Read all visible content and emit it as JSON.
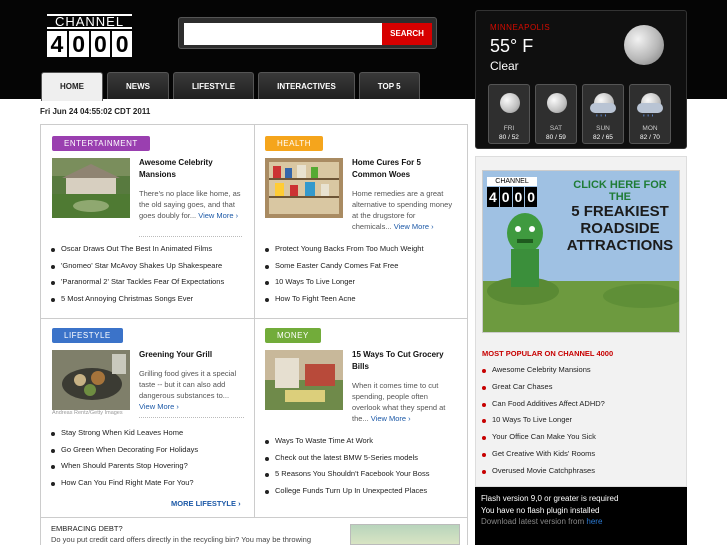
{
  "logo": {
    "top": "CHANNEL",
    "digits": [
      "4",
      "0",
      "0",
      "0"
    ]
  },
  "search": {
    "placeholder": "",
    "button": "SEARCH"
  },
  "nav": [
    {
      "label": "HOME"
    },
    {
      "label": "NEWS"
    },
    {
      "label": "LIFESTYLE"
    },
    {
      "label": "INTERACTIVES"
    },
    {
      "label": "TOP 5"
    }
  ],
  "date": "Fri Jun 24 04:55:02 CDT 2011",
  "sections": {
    "entertainment": {
      "badge": "ENTERTAINMENT",
      "color": "#9a3fb0",
      "bullet_color": "#a23ab5",
      "title": "Awesome Celebrity Mansions",
      "text": "There's no place like home, as the old saying goes, and that goes doubly for...",
      "more": "View More ›",
      "items": [
        "Oscar Draws Out The Best In Animated Films",
        "'Gnomeo' Star McAvoy Shakes Up Shakespeare",
        "'Paranormal 2' Star Tackles Fear Of Expectations",
        "5 Most Annoying Christmas Songs Ever"
      ]
    },
    "health": {
      "badge": "HEALTH",
      "color": "#f5a51c",
      "bullet_color": "#f5a51c",
      "title": "Home Cures For 5 Common Woes",
      "text": "Home remedies are a great alternative to spending money at the drugstore for chemicals...",
      "more": "View More ›",
      "items": [
        "Protect Young Backs From Too Much Weight",
        "Some Easter Candy Comes Fat Free",
        "10 Ways To Live Longer",
        "How To Fight Teen Acne"
      ]
    },
    "lifestyle": {
      "badge": "LIFESTYLE",
      "color": "#3b73c9",
      "bullet_color": "#3b73c9",
      "title": "Greening Your Grill",
      "text": "Grilling food gives it a special taste -- but it can also add dangerous substances to...",
      "more": "View More ›",
      "credit": "Andreas Rentz/Getty Images",
      "items": [
        "Stay Strong When Kid Leaves Home",
        "Go Green When Decorating For Holidays",
        "When Should Parents Stop Hovering?",
        "How Can You Find Right Mate For You?"
      ],
      "more_section": "MORE LIFESTYLE ›"
    },
    "money": {
      "badge": "MONEY",
      "color": "#72ac3a",
      "bullet_color": "#72ac3a",
      "title": "15 Ways To Cut Grocery Bills",
      "text": "When it comes time to cut spending, people often overlook what they spend at the...",
      "more": "View More ›",
      "items": [
        "Ways To Waste Time At Work",
        "Check out the latest BMW 5-Series models",
        "5 Reasons You Shouldn't Facebook Your Boss",
        "College Funds Turn Up In Unexpected Places"
      ]
    }
  },
  "bottom": {
    "heading": "EMBRACING DEBT?",
    "text": "Do you put credit card offers directly in the recycling bin? You may be throwing"
  },
  "weather": {
    "city": "MINNEAPOLIS",
    "temp": "55° F",
    "condition": "Clear",
    "icon": "moon-icon",
    "forecast": [
      {
        "day": "FRI",
        "temps": "80 / 52",
        "icon": "moon-icon"
      },
      {
        "day": "SAT",
        "temps": "80 / 59",
        "icon": "moon-icon"
      },
      {
        "day": "SUN",
        "temps": "82 / 65",
        "icon": "rain-icon"
      },
      {
        "day": "MON",
        "temps": "82 / 70",
        "icon": "rain-icon"
      }
    ]
  },
  "ad": {
    "logo_top": "CHANNEL",
    "logo_digits": [
      "4",
      "0",
      "0",
      "0"
    ],
    "line1": "CLICK HERE FOR THE",
    "line2": "5 FREAKIEST",
    "line3": "ROADSIDE",
    "line4": "ATTRACTIONS"
  },
  "popular": {
    "title": "MOST POPULAR ON CHANNEL 4000",
    "items": [
      "Awesome Celebrity Mansions",
      "Great Car Chases",
      "Can Food Additives Affect ADHD?",
      "10 Ways To Live Longer",
      "Your Office Can Make You Sick",
      "Get Creative With Kids' Rooms",
      "Overused Movie Catchphrases"
    ]
  },
  "flash": {
    "line1": "Flash version 9,0 or greater is required",
    "line2": "You have no flash plugin installed",
    "line3_prefix": "Download latest version from",
    "line3_link": "here"
  },
  "colors": {
    "accent_red": "#d70000",
    "link_blue": "#1c59a7"
  }
}
